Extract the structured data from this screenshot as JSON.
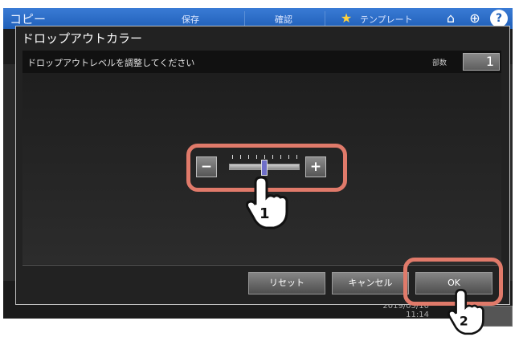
{
  "topbar": {
    "title": "コピー",
    "items": [
      "保存",
      "確認",
      "テンプレート"
    ],
    "star_icon": "star-icon",
    "home_icon": "home-icon",
    "globe_icon": "globe-icon",
    "help_icon": "help-icon"
  },
  "status": {
    "date": "2019/05/10",
    "time": "11:14"
  },
  "modal": {
    "title": "ドロップアウトカラー",
    "instruction": "ドロップアウトレベルを調整してください",
    "copies_label": "部数",
    "copies_value": "1",
    "slider": {
      "minus_label": "−",
      "plus_label": "+",
      "level": 0.5
    },
    "buttons": {
      "reset": "リセット",
      "cancel": "キャンセル",
      "ok": "OK"
    }
  },
  "callouts": {
    "step1": "1",
    "step2": "2"
  },
  "colors": {
    "topbar": "#2a6cc9",
    "highlight": "#e07a6a",
    "thumb": "#6e6ec8"
  }
}
